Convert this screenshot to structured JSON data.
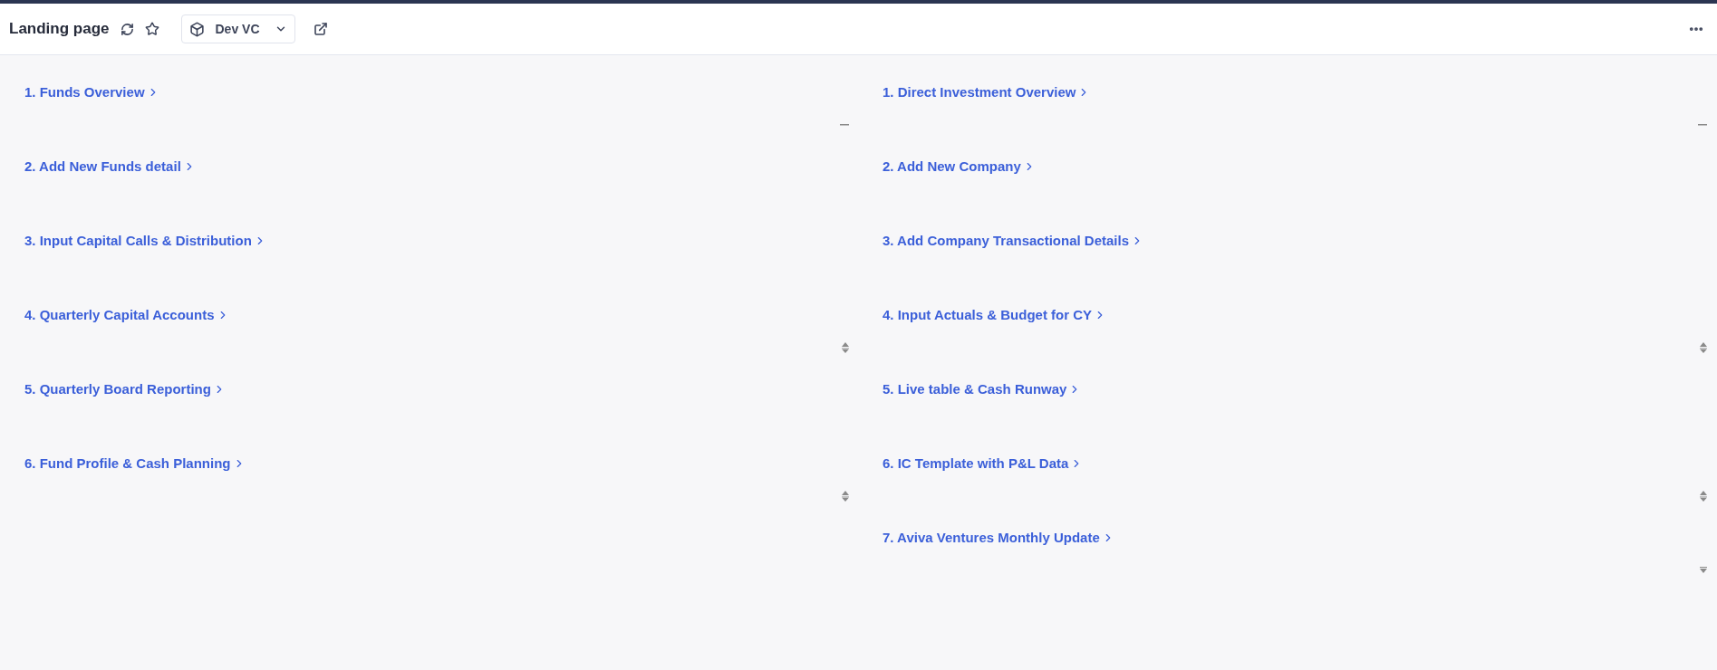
{
  "header": {
    "title": "Landing page",
    "workspace": "Dev VC"
  },
  "columns": [
    {
      "items": [
        {
          "label": "1. Funds Overview",
          "kind": "collapse"
        },
        {
          "label": "2. Add New Funds detail",
          "kind": "plain"
        },
        {
          "label": "3. Input Capital Calls & Distribution",
          "kind": "plain"
        },
        {
          "label": "4. Quarterly Capital Accounts",
          "kind": "resize"
        },
        {
          "label": "5. Quarterly Board Reporting",
          "kind": "plain"
        },
        {
          "label": "6. Fund Profile & Cash Planning",
          "kind": "resize"
        }
      ]
    },
    {
      "items": [
        {
          "label": "1. Direct Investment Overview",
          "kind": "collapse"
        },
        {
          "label": "2. Add New Company",
          "kind": "plain"
        },
        {
          "label": "3. Add Company Transactional Details",
          "kind": "plain"
        },
        {
          "label": "4. Input Actuals & Budget for CY",
          "kind": "resize"
        },
        {
          "label": "5. Live table & Cash Runway",
          "kind": "plain"
        },
        {
          "label": "6. IC Template with P&L Data",
          "kind": "resize"
        },
        {
          "label": "7. Aviva Ventures Monthly Update",
          "kind": "lastresize"
        }
      ]
    }
  ]
}
